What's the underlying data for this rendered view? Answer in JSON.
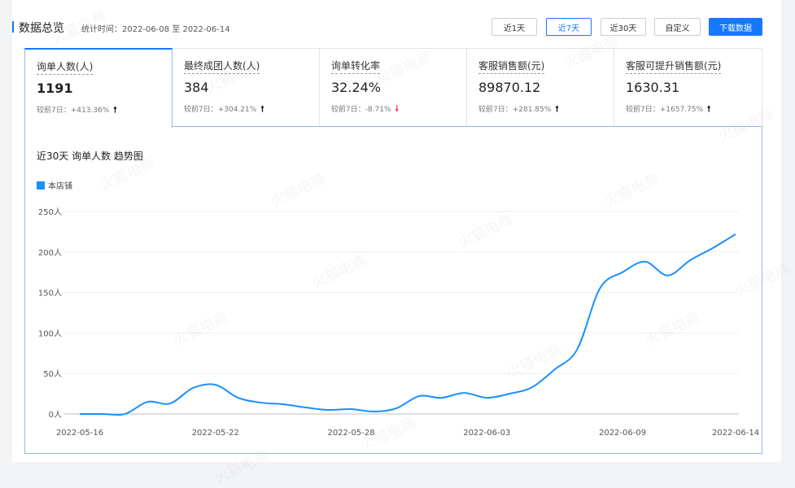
{
  "header": {
    "title": "数据总览",
    "time_range": "统计时间：2022-06-08 至 2022-06-14"
  },
  "range_buttons": [
    {
      "label": "近1天",
      "active": false
    },
    {
      "label": "近7天",
      "active": true
    },
    {
      "label": "近30天",
      "active": false
    },
    {
      "label": "自定义",
      "active": false
    }
  ],
  "download_label": "下载数据",
  "metrics": [
    {
      "label": "询单人数(人)",
      "value": "1191",
      "compare": "较前7日：+413.36%",
      "trend": "up"
    },
    {
      "label": "最终成团人数(人)",
      "value": "384",
      "compare": "较前7日：+304.21%",
      "trend": "up"
    },
    {
      "label": "询单转化率",
      "value": "32.24%",
      "compare": "较前7日：-8.71%",
      "trend": "down"
    },
    {
      "label": "客服销售额(元)",
      "value": "89870.12",
      "compare": "较前7日：+281.85%",
      "trend": "up"
    },
    {
      "label": "客服可提升销售额(元)",
      "value": "1630.31",
      "compare": "较前7日：+1657.75%",
      "trend": "up"
    }
  ],
  "watermark": "火猫电商",
  "colors": {
    "accent": "#1677ff",
    "series": "#1890ff",
    "down": "#f03a3a"
  },
  "chart_data": {
    "type": "line",
    "title": "近30天 询单人数 趋势图",
    "xlabel": "",
    "ylabel": "",
    "x_tick_labels": [
      "2022-05-16",
      "2022-05-22",
      "2022-05-28",
      "2022-06-03",
      "2022-06-09",
      "2022-06-14"
    ],
    "y_tick_labels": [
      "0人",
      "50人",
      "100人",
      "150人",
      "200人",
      "250人"
    ],
    "ylim": [
      0,
      250
    ],
    "x": [
      "2022-05-16",
      "2022-05-17",
      "2022-05-18",
      "2022-05-19",
      "2022-05-20",
      "2022-05-21",
      "2022-05-22",
      "2022-05-23",
      "2022-05-24",
      "2022-05-25",
      "2022-05-26",
      "2022-05-27",
      "2022-05-28",
      "2022-05-29",
      "2022-05-30",
      "2022-05-31",
      "2022-06-01",
      "2022-06-02",
      "2022-06-03",
      "2022-06-04",
      "2022-06-05",
      "2022-06-06",
      "2022-06-07",
      "2022-06-08",
      "2022-06-09",
      "2022-06-10",
      "2022-06-11",
      "2022-06-12",
      "2022-06-13",
      "2022-06-14"
    ],
    "series": [
      {
        "name": "本店铺",
        "values": [
          0,
          0,
          0,
          15,
          13,
          32,
          36,
          20,
          14,
          12,
          8,
          5,
          6,
          3,
          7,
          22,
          20,
          26,
          20,
          25,
          33,
          55,
          80,
          155,
          175,
          188,
          171,
          190,
          205,
          222
        ]
      }
    ],
    "legend": "top-left",
    "grid": true
  }
}
